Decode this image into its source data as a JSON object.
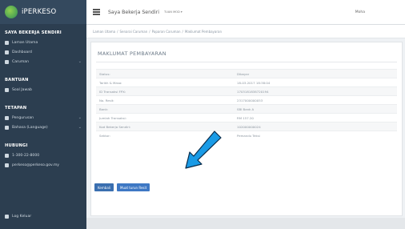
{
  "brand": {
    "name": "iPERKESO"
  },
  "sidebar": {
    "heading": "SAYA BEKERJA SENDIRI",
    "items": [
      {
        "label": "Laman Utama",
        "icon": "home-icon"
      },
      {
        "label": "Dashboard",
        "icon": "dashboard-icon"
      },
      {
        "label": "Caruman",
        "icon": "card-icon"
      }
    ],
    "sections": [
      {
        "heading": "BANTUAN",
        "items": [
          {
            "label": "Soal Jawab",
            "icon": "question-icon"
          }
        ]
      },
      {
        "heading": "TETAPAN",
        "items": [
          {
            "label": "Pengurusan",
            "icon": "gear-icon"
          },
          {
            "label": "Bahasa (Language)",
            "icon": "language-icon"
          }
        ]
      },
      {
        "heading": "HUBUNGI",
        "items": [
          {
            "label": "1-300-22-8000",
            "icon": "phone-icon"
          },
          {
            "label": "perkeso@perkeso.gov.my",
            "icon": "mail-icon"
          }
        ]
      }
    ],
    "logout": "Log Keluar"
  },
  "topbar": {
    "title": "Saya Bekerja Sendiri",
    "account": "TUAN MOD ▾",
    "user": "Moha"
  },
  "breadcrumb": [
    "Laman Utama",
    "Senarai Caruman",
    "Paparan Caruman",
    "Maklumat Pembayaran"
  ],
  "card": {
    "title": "MAKLUMAT PEMBAYARAN",
    "rows": [
      {
        "label": "Status:",
        "value": "Dibayar"
      },
      {
        "label": "Tarikh & Masa:",
        "value": "18-03-2017 18:38:04"
      },
      {
        "label": "ID Transaksi FPX:",
        "value": "1703181838720194"
      },
      {
        "label": "No. Resit:",
        "value": "2317000000053"
      },
      {
        "label": "Bank:",
        "value": "SBI Bank A"
      },
      {
        "label": "Jumlah Transaksi:",
        "value": "RM 157.20"
      },
      {
        "label": "Kod Bekerja Sendiri:",
        "value": "102000000024"
      },
      {
        "label": "Sektor:",
        "value": "Pemandu Teksi"
      }
    ],
    "buttons": {
      "back": "Kembali",
      "receipt": "Muat turun Resit"
    }
  },
  "colors": {
    "sidebar": "#2c3e50",
    "accent": "#3a6fb0",
    "arrow": "#1a9be6"
  }
}
